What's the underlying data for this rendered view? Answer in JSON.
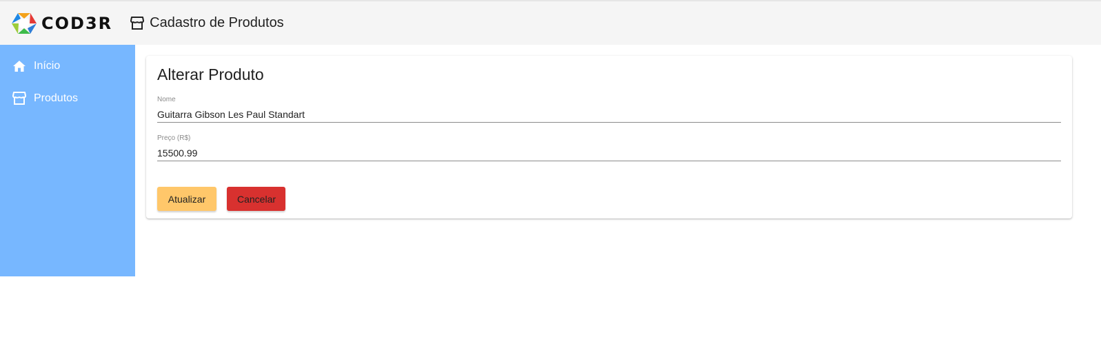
{
  "header": {
    "logo_text": "COD3R",
    "page_title": "Cadastro de Produtos",
    "page_icon": "storefront-icon"
  },
  "sidebar": {
    "items": [
      {
        "label": "Início",
        "icon": "home-icon"
      },
      {
        "label": "Produtos",
        "icon": "storefront-icon"
      }
    ]
  },
  "form": {
    "title": "Alterar Produto",
    "name_label": "Nome",
    "name_value": "Guitarra Gibson Les Paul Standart",
    "price_label": "Preço (R$)",
    "price_value": "15500.99",
    "update_label": "Atualizar",
    "cancel_label": "Cancelar"
  },
  "colors": {
    "sidebar": "#77b7ff",
    "update_button": "#ffc76a",
    "cancel_button": "#d8312f"
  }
}
